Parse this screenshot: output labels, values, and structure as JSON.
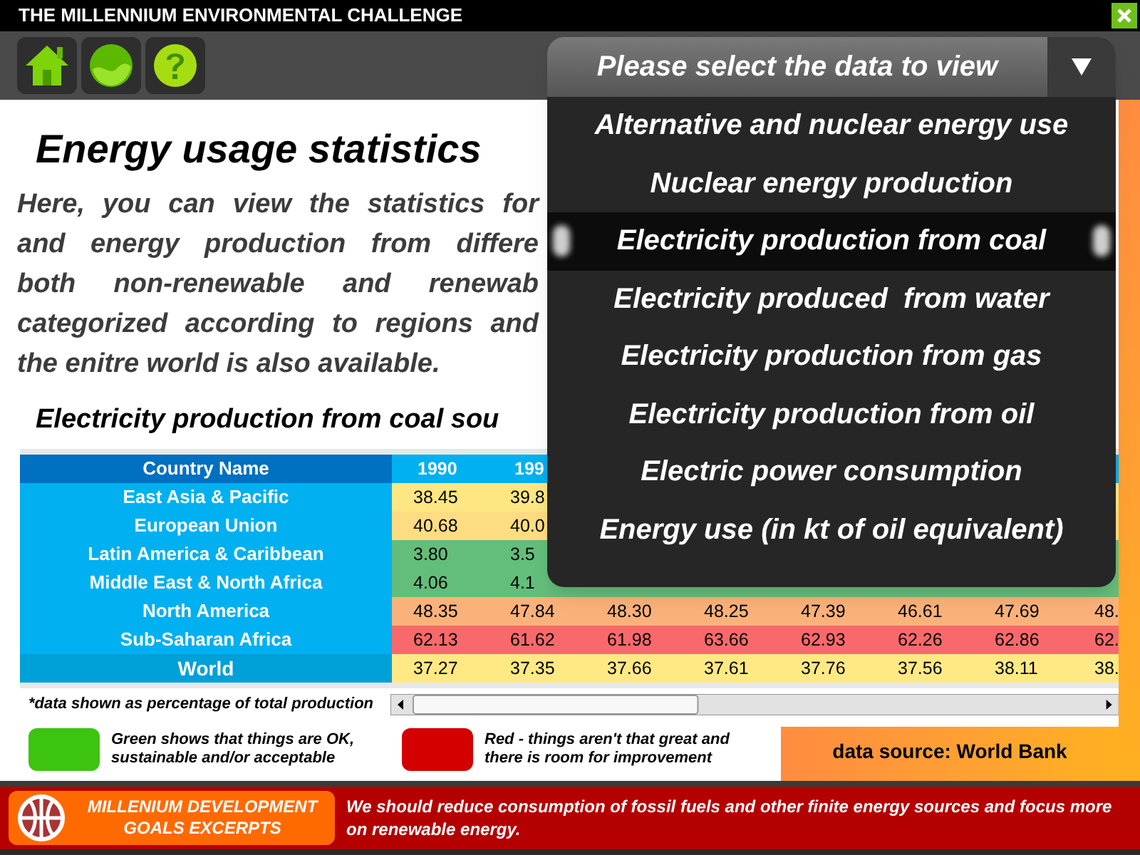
{
  "app_title": "THE MILLENNIUM ENVIRONMENTAL CHALLENGE",
  "toolbar": [
    {
      "kind": "home"
    },
    {
      "kind": "globe"
    },
    {
      "kind": "help"
    }
  ],
  "heading": "Energy usage statistics",
  "intro_lines": [
    "Here, you can view the statistics for",
    "and energy production from differe",
    "both non-renewable and renewab",
    "categorized according to regions and",
    "the enitre world is also available."
  ],
  "table": {
    "title": "Electricity production from coal sou",
    "columns": [
      "Country Name",
      "1990",
      "199"
    ],
    "rows": [
      {
        "name": "East Asia & Pacific",
        "kind": "region",
        "color": "#fee683",
        "values": [
          "38.45",
          "39.8"
        ]
      },
      {
        "name": "European Union",
        "kind": "region",
        "color": "#fddc82",
        "values": [
          "40.68",
          "40.0"
        ]
      },
      {
        "name": "Latin America & Caribbean",
        "kind": "region",
        "color": "#63be7b",
        "values": [
          "3.80",
          "3.5"
        ]
      },
      {
        "name": "Middle East & North Africa",
        "kind": "region",
        "color": "#63be7b",
        "values": [
          "4.06",
          "4.1"
        ]
      },
      {
        "name": "North America",
        "kind": "region",
        "color": "#fbb27a",
        "values": [
          "48.35",
          "47.84",
          "48.30",
          "48.25",
          "47.39",
          "46.61",
          "47.69",
          "48."
        ]
      },
      {
        "name": "Sub-Saharan Africa",
        "kind": "region",
        "color": "#f8696b",
        "values": [
          "62.13",
          "61.62",
          "61.98",
          "63.66",
          "62.93",
          "62.26",
          "62.86",
          "62."
        ]
      },
      {
        "name": "World",
        "kind": "total",
        "color": "#ffe984",
        "values": [
          "37.27",
          "37.35",
          "37.66",
          "37.61",
          "37.76",
          "37.56",
          "38.11",
          "38."
        ]
      }
    ]
  },
  "note": "*data shown as percentage of total production",
  "legend": [
    {
      "text": "Green shows that things are OK, sustainable and/or acceptable",
      "color": "#3cc410"
    },
    {
      "text": "Red - things aren't that great and there is room for improvement",
      "color": "#d40000"
    }
  ],
  "source": "data source: World Bank",
  "dropdown": {
    "prompt": "Please select the data to view",
    "expanded": true,
    "options": [
      {
        "label": "Alternative and nuclear energy use",
        "selected": false
      },
      {
        "label": "Nuclear energy production",
        "selected": false
      },
      {
        "label": "Electricity production from coal",
        "selected": true
      },
      {
        "label": "Electricity produced  from water",
        "selected": false
      },
      {
        "label": "Electricity production from gas",
        "selected": false
      },
      {
        "label": "Electricity production from oil",
        "selected": false
      },
      {
        "label": "Electric power consumption",
        "selected": false
      },
      {
        "label": "Energy use (in kt of oil equivalent)",
        "selected": false
      }
    ]
  },
  "banner": {
    "badge": "MILLENIUM DEVELOPMENT GOALS EXCERPTS",
    "message": "We should reduce consumption of fossil fuels and other finite energy sources and focus more on renewable energy."
  }
}
